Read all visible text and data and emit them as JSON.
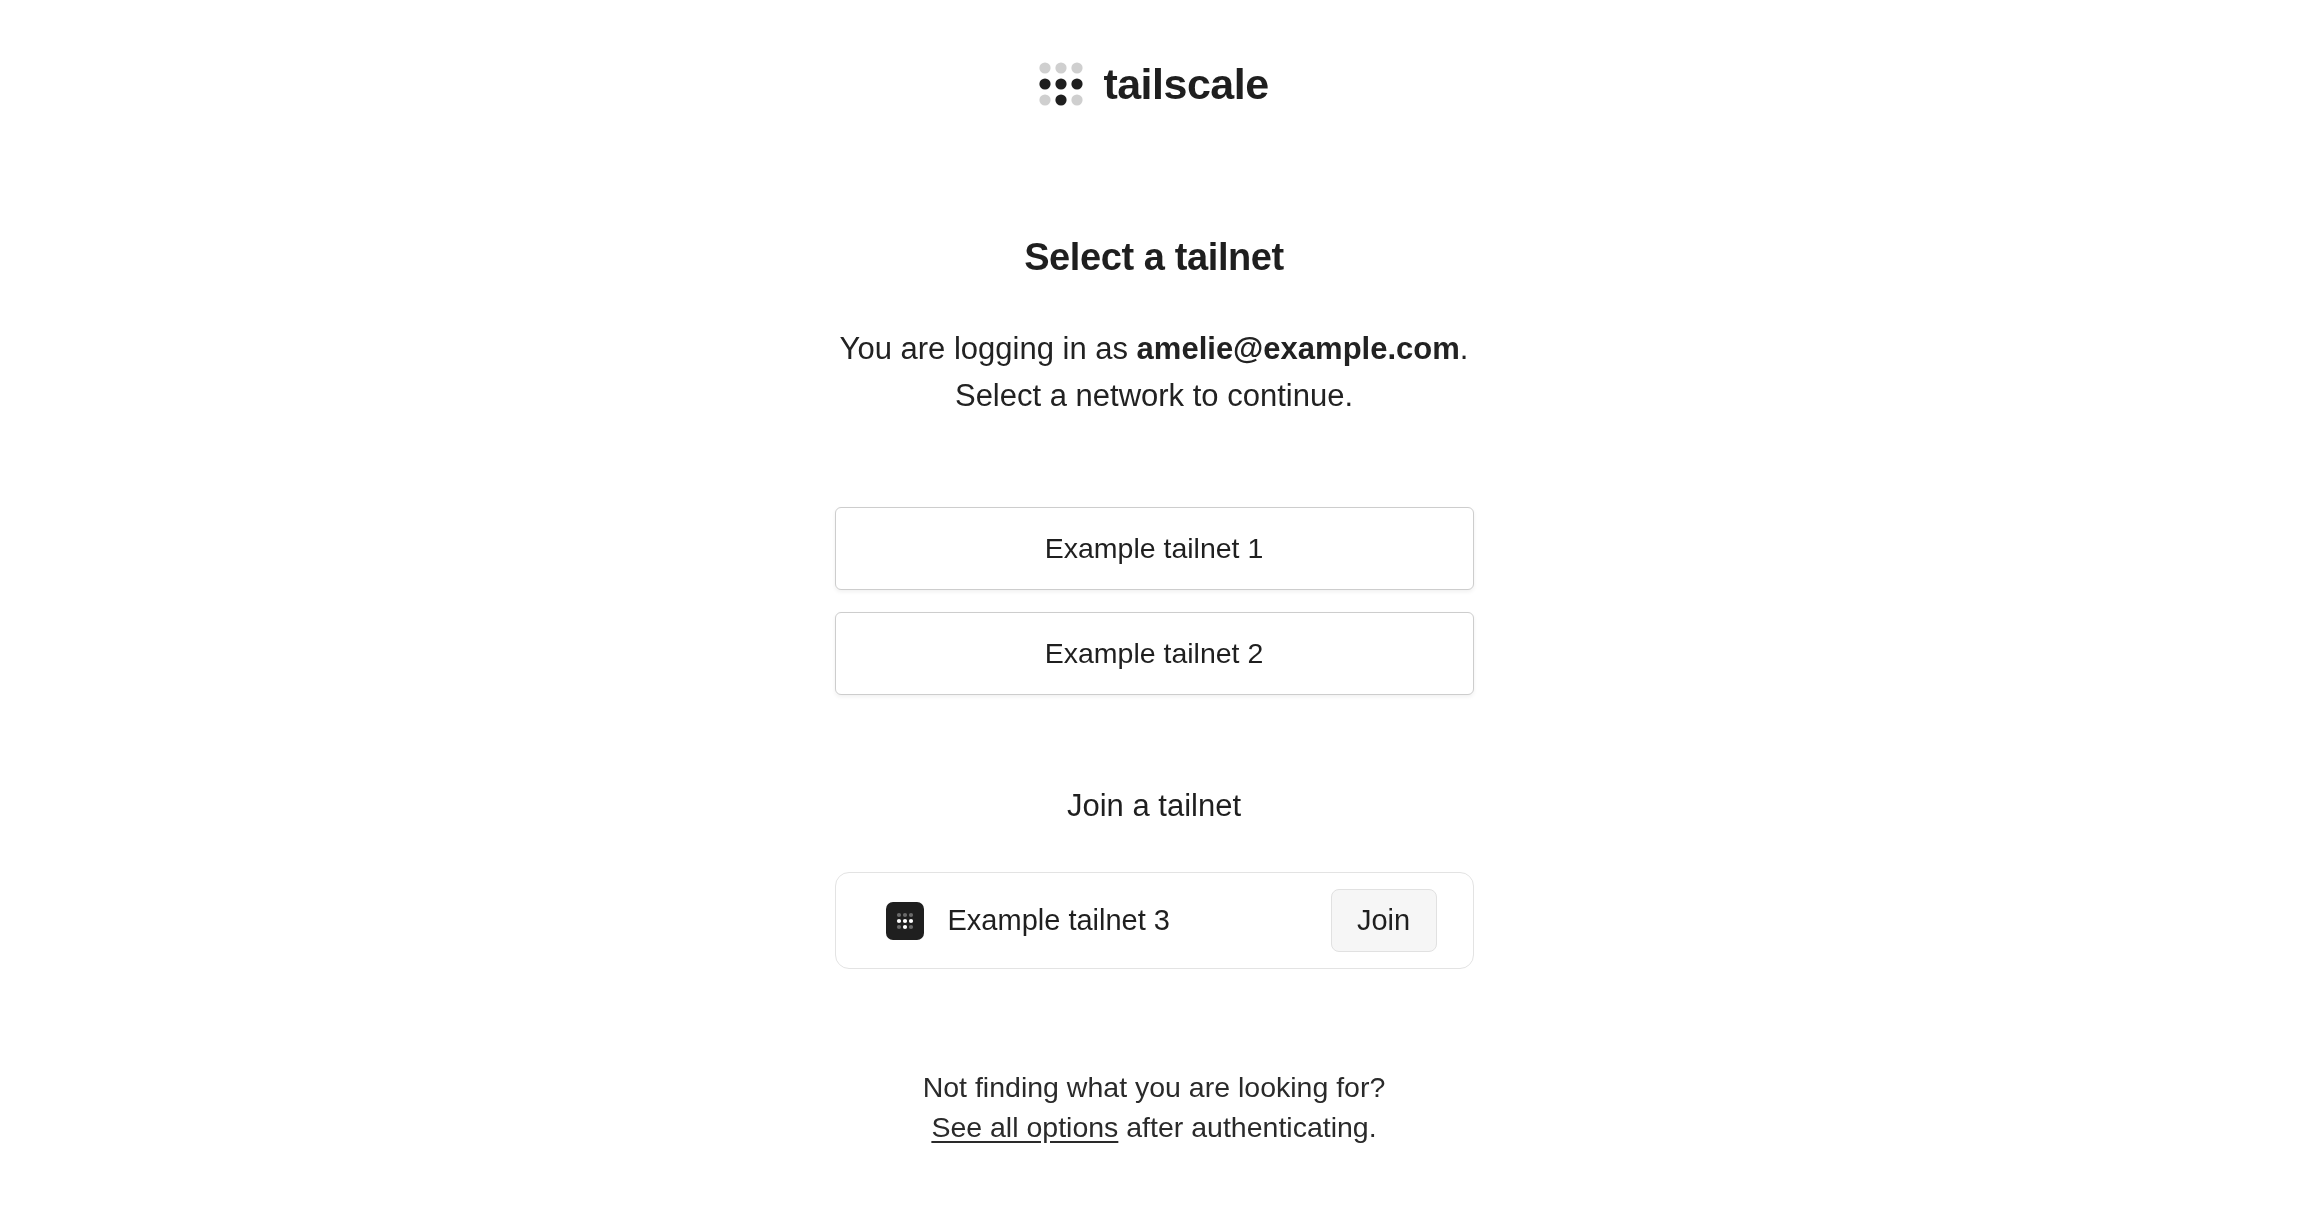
{
  "header": {
    "logo_text": "tailscale"
  },
  "title": "Select a tailnet",
  "intro": [
    "You are logging in as **amelie@example.com**.",
    "Select a network to continue."
  ],
  "tailnets": [
    {
      "label": "Example tailnet 1"
    },
    {
      "label": "Example tailnet 2"
    }
  ],
  "join": {
    "heading": "Join a tailnet",
    "items": [
      {
        "name": "Example tailnet 3",
        "button": "Join"
      }
    ]
  },
  "footer": {
    "question": "Not finding what you are looking for?",
    "link": "See all options",
    "rest": "after authenticating."
  }
}
